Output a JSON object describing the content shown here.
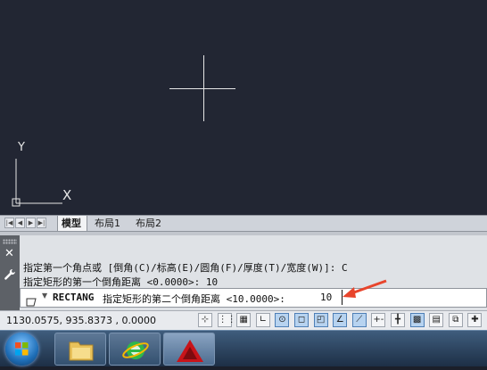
{
  "tabs": {
    "model": "模型",
    "layout1": "布局1",
    "layout2": "布局2",
    "nav": [
      "|◀",
      "◀",
      "▶",
      "▶|"
    ]
  },
  "ucs": {
    "y_label": "Y",
    "x_label": "X"
  },
  "command": {
    "history_line1": "指定第一个角点或 [倒角(C)/标高(E)/圆角(F)/厚度(T)/宽度(W)]: C",
    "history_line2": "指定矩形的第一个倒角距离 <0.0000>: 10",
    "current_command": "RECTANG",
    "prompt": "指定矩形的第二个倒角距离 <10.0000>:",
    "input_value": "10"
  },
  "status": {
    "coordinates": "1130.0575, 935.8373 , 0.0000",
    "buttons": [
      {
        "name": "infer-constraints-button",
        "glyph": "⊹",
        "on": false
      },
      {
        "name": "snap-mode-button",
        "glyph": "⋮⋮",
        "on": false
      },
      {
        "name": "grid-display-button",
        "glyph": "▦",
        "on": false
      },
      {
        "name": "ortho-mode-button",
        "glyph": "∟",
        "on": false
      },
      {
        "name": "polar-tracking-button",
        "glyph": "⊙",
        "on": true
      },
      {
        "name": "object-snap-button",
        "glyph": "◻",
        "on": true
      },
      {
        "name": "3d-object-snap-button",
        "glyph": "◰",
        "on": true
      },
      {
        "name": "object-snap-tracking-button",
        "glyph": "∠",
        "on": true
      },
      {
        "name": "dynamic-ucs-button",
        "glyph": "⟋",
        "on": true
      },
      {
        "name": "dynamic-input-button",
        "glyph": "+-",
        "on": false
      },
      {
        "name": "lineweight-button",
        "glyph": "╋",
        "on": false
      },
      {
        "name": "transparency-button",
        "glyph": "▩",
        "on": true
      },
      {
        "name": "quick-properties-button",
        "glyph": "▤",
        "on": false
      },
      {
        "name": "selection-cycling-button",
        "glyph": "⧉",
        "on": false
      },
      {
        "name": "annotation-monitor-button",
        "glyph": "✚",
        "on": false
      }
    ]
  },
  "colors": {
    "canvas": "#222633",
    "accent_arrow": "#e8452c",
    "cad_red": "#c8141a"
  },
  "taskbar": {
    "items": [
      {
        "name": "start-button-icon"
      },
      {
        "name": "file-explorer-icon"
      },
      {
        "name": "internet-explorer-icon"
      },
      {
        "name": "autocad-icon"
      }
    ]
  }
}
